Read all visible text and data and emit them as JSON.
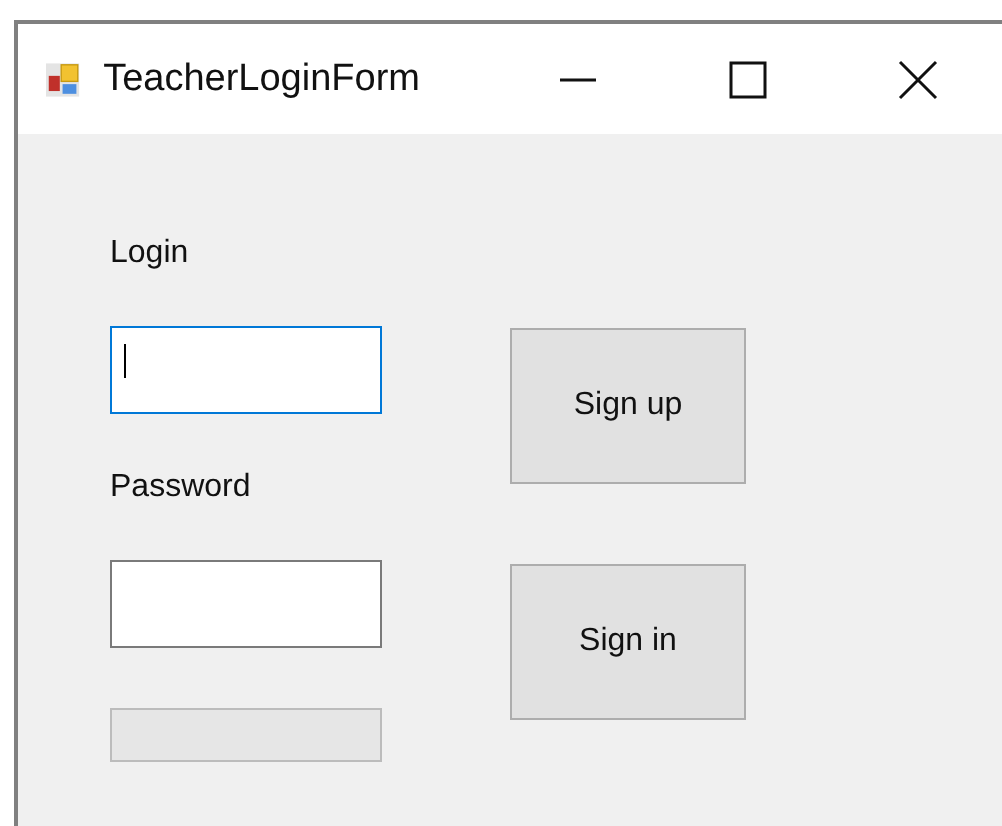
{
  "window": {
    "title": "TeacherLoginForm",
    "controls": [
      {
        "kind": "minimize"
      },
      {
        "kind": "maximize"
      },
      {
        "kind": "close"
      }
    ]
  },
  "form": {
    "fields": [
      {
        "label": "Login",
        "focused": true
      },
      {
        "label": "Password",
        "focused": false
      }
    ],
    "progress": {
      "level": 0
    },
    "buttons": [
      {
        "label": "Sign up"
      },
      {
        "label": "Sign in"
      }
    ]
  }
}
